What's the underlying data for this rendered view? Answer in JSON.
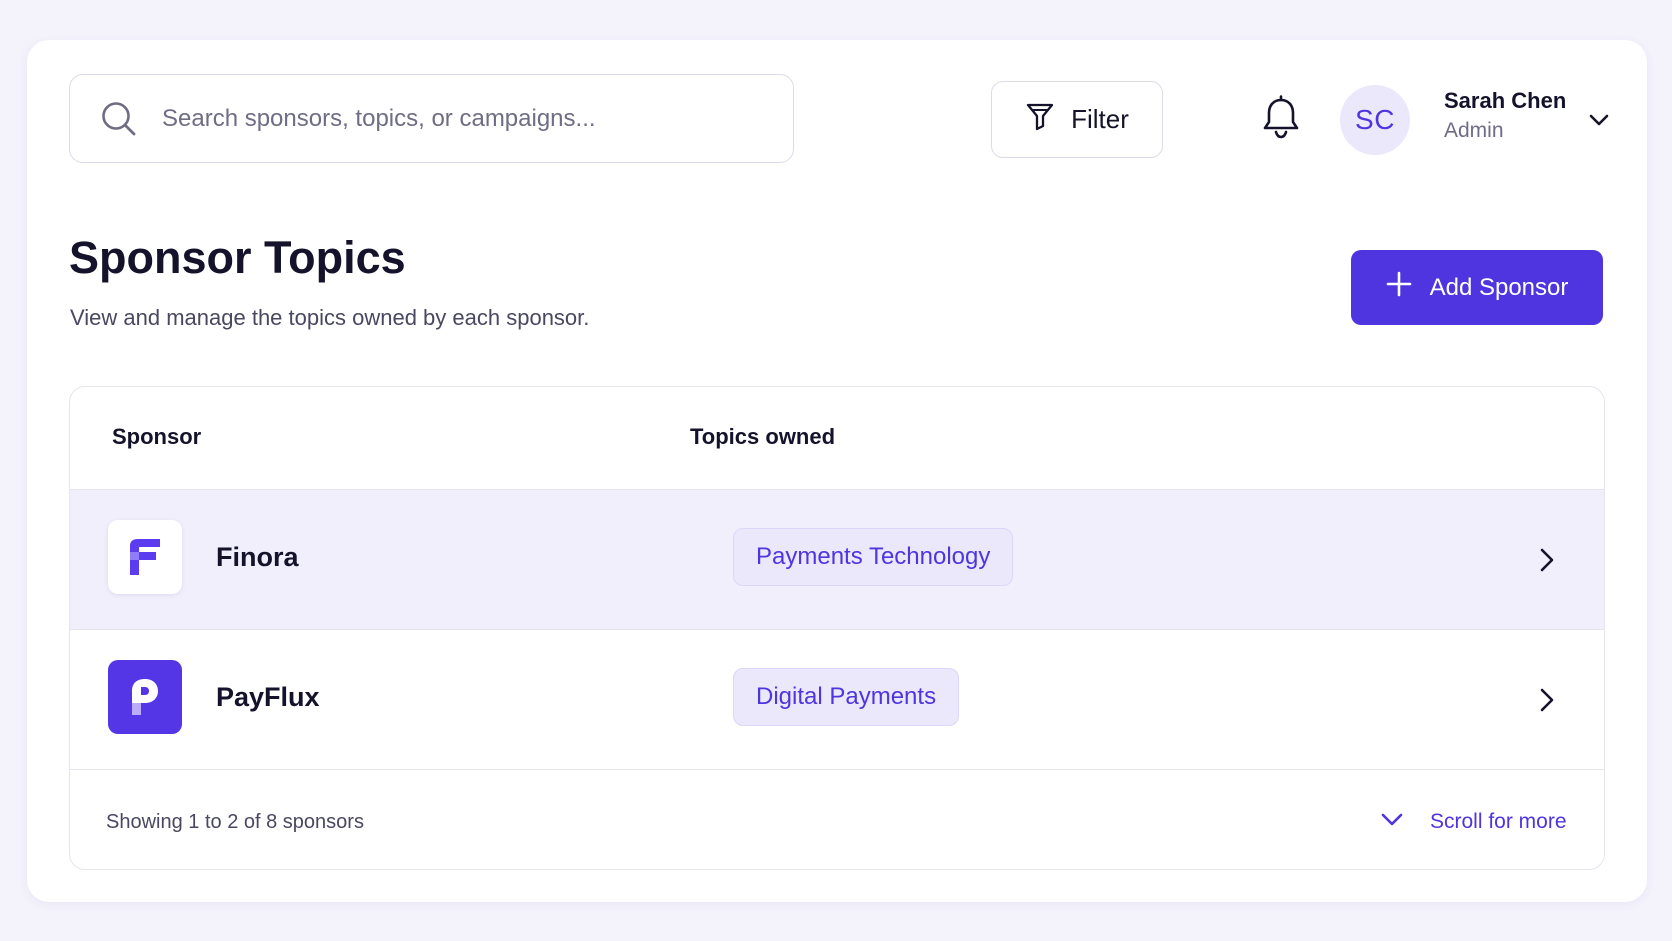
{
  "search": {
    "placeholder": "Search sponsors, topics, or campaigns..."
  },
  "toolbar": {
    "filter_label": "Filter"
  },
  "user": {
    "initials": "SC",
    "name": "Sarah Chen",
    "role": "Admin"
  },
  "page": {
    "title": "Sponsor Topics",
    "subtitle": "View and manage the topics owned by each sponsor.",
    "add_label": "Add Sponsor"
  },
  "table": {
    "columns": [
      "Sponsor",
      "Topics owned"
    ],
    "rows": [
      {
        "sponsor": "Finora",
        "logo_letter": "F",
        "topic": "Payments Technology"
      },
      {
        "sponsor": "PayFlux",
        "logo_letter": "P",
        "topic": "Digital Payments"
      }
    ],
    "footer_text": "Showing 1 to 2 of 8 sponsors",
    "scroll_label": "Scroll for more"
  },
  "colors": {
    "accent": "#4f35e0",
    "background": "#f4f3fc",
    "selected_row": "#f1effc",
    "tag_bg": "#ebe8fb"
  },
  "icons": [
    "search-icon",
    "filter-icon",
    "bell-icon",
    "chevron-down-icon",
    "plus-icon",
    "chevron-right-icon"
  ]
}
